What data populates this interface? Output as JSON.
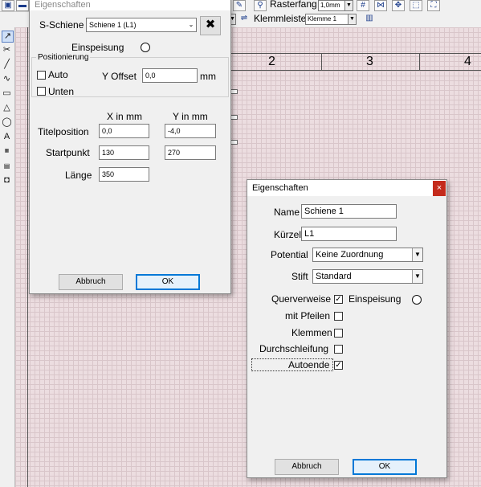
{
  "toolbar": {
    "raster_label": "Rasterfang",
    "raster_value": "1,0mm",
    "klemmleiste_label": "Klemmleiste",
    "klemmleiste_value": "Klemme 1"
  },
  "ruler": {
    "numbers": [
      "2",
      "3",
      "4"
    ]
  },
  "dialog1": {
    "title": "Eigenschaften",
    "s_schiene_label": "S-Schiene",
    "s_schiene_value": "Schiene 1 (L1)",
    "einspeisung_label": "Einspeisung",
    "positionierung_label": "Positionierung",
    "auto_label": "Auto",
    "unten_label": "Unten",
    "yoffset_label": "Y Offset",
    "yoffset_value": "0,0",
    "yoffset_unit": "mm",
    "x_header": "X in mm",
    "y_header": "Y in mm",
    "titelposition_label": "Titelposition",
    "titelposition_x": "0,0",
    "titelposition_y": "-4,0",
    "startpunkt_label": "Startpunkt",
    "startpunkt_x": "130",
    "startpunkt_y": "270",
    "laenge_label": "Länge",
    "laenge_value": "350",
    "cancel_label": "Abbruch",
    "ok_label": "OK"
  },
  "dialog2": {
    "title": "Eigenschaften",
    "close_label": "×",
    "name_label": "Name",
    "name_value": "Schiene 1",
    "kuerzel_label": "Kürzel",
    "kuerzel_value": "L1",
    "potential_label": "Potential",
    "potential_value": "Keine Zuordnung",
    "stift_label": "Stift",
    "stift_value": "Standard",
    "querverweise_label": "Querverweise",
    "querverweise_checked": "✓",
    "einspeisung_label": "Einspeisung",
    "mit_pfeilen_label": "mit Pfeilen",
    "klemmen_label": "Klemmen",
    "durchschleifung_label": "Durchschleifung",
    "autoende_label": "Autoende",
    "autoende_checked": "✓",
    "cancel_label": "Abbruch",
    "ok_label": "OK"
  }
}
